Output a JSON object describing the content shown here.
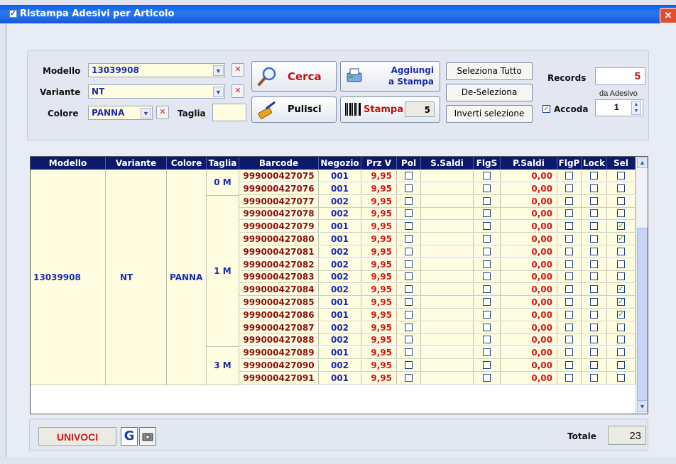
{
  "window": {
    "title": "Ristampa Adesivi per Articolo",
    "close_glyph": "✕"
  },
  "filters": {
    "modello_label": "Modello",
    "modello_value": "13039908",
    "variante_label": "Variante",
    "variante_value": "NT",
    "colore_label": "Colore",
    "colore_value": "PANNA",
    "taglia_label": "Taglia",
    "taglia_value": ""
  },
  "buttons": {
    "cerca": "Cerca",
    "pulisci": "Pulisci",
    "aggiungi_line1": "Aggiungi",
    "aggiungi_line2": "a Stampa",
    "stampa": "Stampa",
    "stampa_count": "5",
    "seleziona_tutto": "Seleziona Tutto",
    "deseleziona": "De-Seleziona",
    "inverti": "Inverti selezione"
  },
  "records": {
    "label": "Records",
    "value": "5",
    "da_adesivo_label": "da Adesivo",
    "accoda_label": "Accoda",
    "accoda_checked": true,
    "accoda_value": "1"
  },
  "grid": {
    "headers": [
      "Modello",
      "Variante",
      "Colore",
      "Taglia",
      "Barcode",
      "Negozio",
      "Prz V",
      "Pol",
      "S.Saldi",
      "FlgS",
      "P.Saldi",
      "FlgP",
      "Lock",
      "Sel"
    ],
    "group": {
      "modello": "13039908",
      "variante": "NT",
      "colore": "PANNA"
    },
    "taglie": [
      {
        "label": "0 M",
        "start": 0,
        "count": 2
      },
      {
        "label": "1 M",
        "start": 2,
        "count": 12
      },
      {
        "label": "3 M",
        "start": 14,
        "count": 3
      }
    ],
    "rows": [
      {
        "barcode": "999000427075",
        "negozio": "001",
        "prz": "9,95",
        "psaldi": "0,00",
        "sel": false
      },
      {
        "barcode": "999000427076",
        "negozio": "001",
        "prz": "9,95",
        "psaldi": "0,00",
        "sel": false
      },
      {
        "barcode": "999000427077",
        "negozio": "002",
        "prz": "9,95",
        "psaldi": "0,00",
        "sel": false
      },
      {
        "barcode": "999000427078",
        "negozio": "002",
        "prz": "9,95",
        "psaldi": "0,00",
        "sel": false
      },
      {
        "barcode": "999000427079",
        "negozio": "001",
        "prz": "9,95",
        "psaldi": "0,00",
        "sel": true
      },
      {
        "barcode": "999000427080",
        "negozio": "001",
        "prz": "9,95",
        "psaldi": "0,00",
        "sel": true
      },
      {
        "barcode": "999000427081",
        "negozio": "002",
        "prz": "9,95",
        "psaldi": "0,00",
        "sel": false
      },
      {
        "barcode": "999000427082",
        "negozio": "002",
        "prz": "9,95",
        "psaldi": "0,00",
        "sel": false
      },
      {
        "barcode": "999000427083",
        "negozio": "002",
        "prz": "9,95",
        "psaldi": "0,00",
        "sel": false
      },
      {
        "barcode": "999000427084",
        "negozio": "002",
        "prz": "9,95",
        "psaldi": "0,00",
        "sel": true
      },
      {
        "barcode": "999000427085",
        "negozio": "001",
        "prz": "9,95",
        "psaldi": "0,00",
        "sel": true
      },
      {
        "barcode": "999000427086",
        "negozio": "001",
        "prz": "9,95",
        "psaldi": "0,00",
        "sel": true
      },
      {
        "barcode": "999000427087",
        "negozio": "002",
        "prz": "9,95",
        "psaldi": "0,00",
        "sel": false
      },
      {
        "barcode": "999000427088",
        "negozio": "002",
        "prz": "9,95",
        "psaldi": "0,00",
        "sel": false
      },
      {
        "barcode": "999000427089",
        "negozio": "001",
        "prz": "9,95",
        "psaldi": "0,00",
        "sel": false
      },
      {
        "barcode": "999000427090",
        "negozio": "002",
        "prz": "9,95",
        "psaldi": "0,00",
        "sel": false
      },
      {
        "barcode": "999000427091",
        "negozio": "001",
        "prz": "9,95",
        "psaldi": "0,00",
        "sel": false
      }
    ]
  },
  "footer": {
    "univoci": "UNIVOCI",
    "g_label": "G",
    "totale_label": "Totale",
    "totale_value": "23"
  },
  "colors": {
    "title_blue": "#1857d8",
    "header_navy": "#0c1a6e",
    "barcode_red": "#8a1010",
    "value_blue": "#1a2bb0",
    "price_red": "#d01818",
    "row_yellow": "#fffde0"
  }
}
